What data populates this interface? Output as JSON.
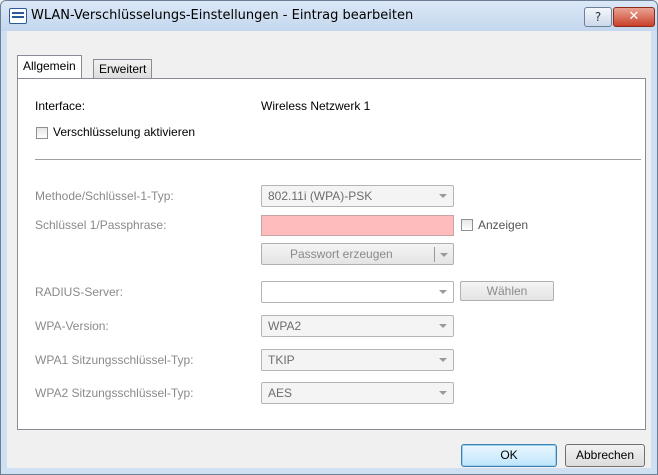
{
  "window": {
    "title": "WLAN-Verschlüsselungs-Einstellungen - Eintrag bearbeiten",
    "help_label": "?",
    "close_label": "✕"
  },
  "tabs": [
    {
      "label": "Allgemein",
      "active": true
    },
    {
      "label": "Erweitert",
      "active": false
    }
  ],
  "general": {
    "interface_label": "Interface:",
    "interface_value": "Wireless Netzwerk 1",
    "encryption_checkbox_label": "Verschlüsselung aktivieren",
    "encryption_checked": false
  },
  "fields": {
    "method_label": "Methode/Schlüssel-1-Typ:",
    "method_value": "802.11i (WPA)-PSK",
    "key_label": "Schlüssel 1/Passphrase:",
    "key_value": "",
    "show_label": "Anzeigen",
    "show_checked": false,
    "generate_password_label": "Passwort erzeugen",
    "radius_label": "RADIUS-Server:",
    "radius_value": "",
    "choose_label": "Wählen",
    "wpa_version_label": "WPA-Version:",
    "wpa_version_value": "WPA2",
    "wpa1_key_type_label": "WPA1 Sitzungsschlüssel-Typ:",
    "wpa1_key_type_value": "TKIP",
    "wpa2_key_type_label": "WPA2 Sitzungsschlüssel-Typ:",
    "wpa2_key_type_value": "AES"
  },
  "footer": {
    "ok_label": "OK",
    "cancel_label": "Abbrechen"
  },
  "colors": {
    "passphrase_invalid_bg": "#ffbcbc",
    "disabled_text": "#8a8a8a"
  }
}
